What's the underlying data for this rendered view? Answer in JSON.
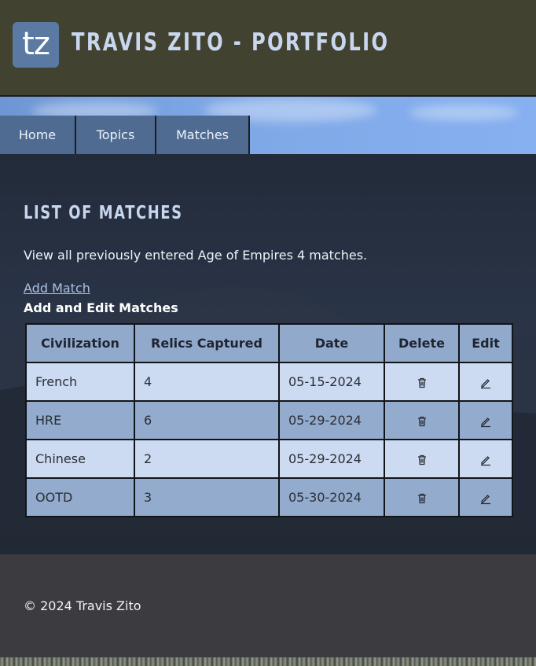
{
  "header": {
    "logo_text": "tz",
    "title": "Travis Zito - Portfolio"
  },
  "nav": {
    "items": [
      {
        "label": "Home"
      },
      {
        "label": "Topics"
      },
      {
        "label": "Matches"
      }
    ]
  },
  "main": {
    "heading": "List of Matches",
    "intro": "View all previously entered Age of Empires 4 matches.",
    "add_link": "Add Match",
    "table_caption": "Add and Edit Matches",
    "columns": [
      "Civilization",
      "Relics Captured",
      "Date",
      "Delete",
      "Edit"
    ],
    "rows": [
      {
        "civilization": "French",
        "relics": "4",
        "date": "05-15-2024",
        "delete_icon": "trash-icon",
        "edit_icon": "pencil-icon"
      },
      {
        "civilization": "HRE",
        "relics": "6",
        "date": "05-29-2024",
        "delete_icon": "trash-icon",
        "edit_icon": "pencil-icon"
      },
      {
        "civilization": "Chinese",
        "relics": "2",
        "date": "05-29-2024",
        "delete_icon": "trash-icon",
        "edit_icon": "pencil-icon"
      },
      {
        "civilization": "OOTD",
        "relics": "3",
        "date": "05-30-2024",
        "delete_icon": "trash-icon",
        "edit_icon": "pencil-icon"
      }
    ]
  },
  "footer": {
    "copyright": "© 2024 Travis Zito"
  },
  "colors": {
    "header_bg": "#414230",
    "nav_bg": "#4f6b92",
    "title_color": "#c9d6ef",
    "table_header_bg": "#91a9cb",
    "row_light": "#ccdaf2",
    "row_dark": "#93abcd",
    "footer_bg": "#3c3c40"
  }
}
